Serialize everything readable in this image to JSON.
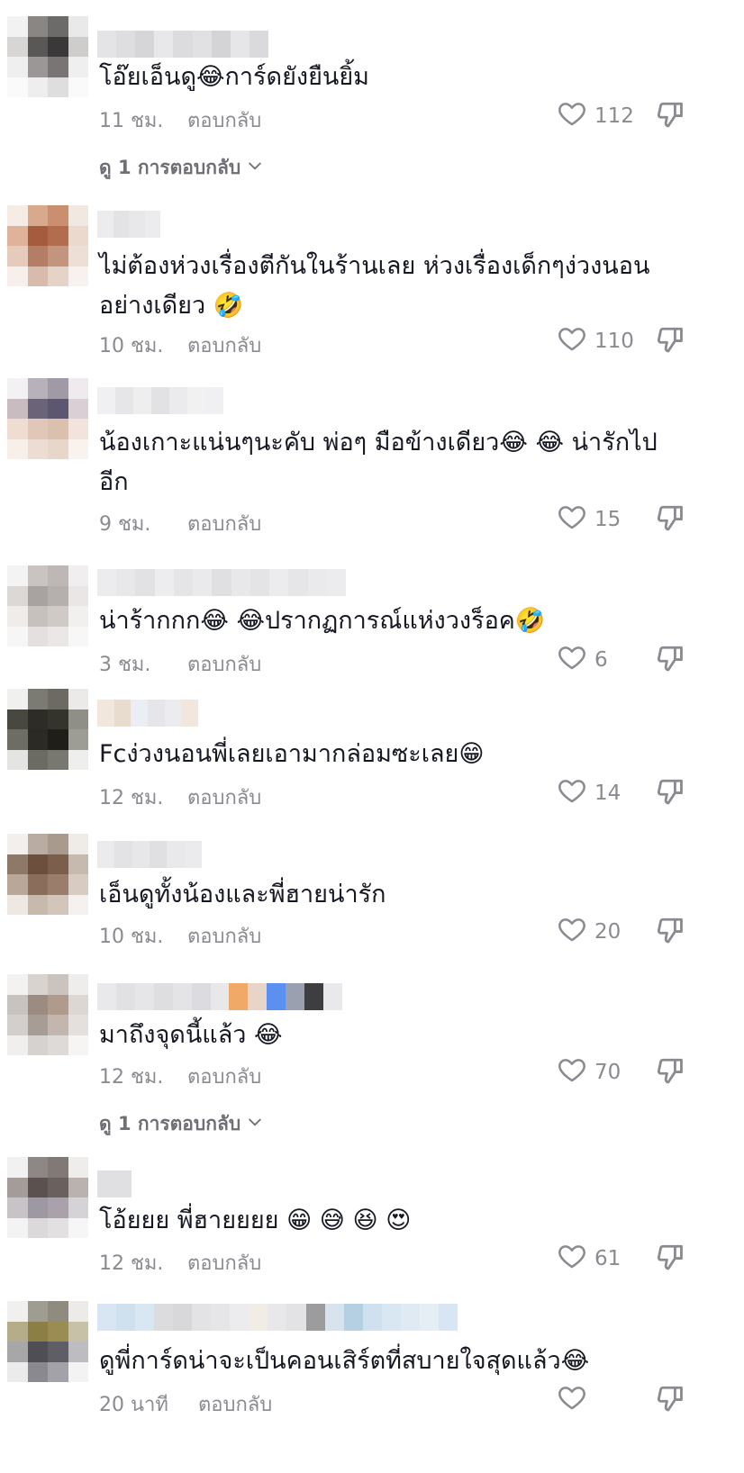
{
  "ui": {
    "reply_label": "ตอบกลับ",
    "text_color": "#161823",
    "meta_color": "#8a8b91",
    "icons": [
      "heart-outline-icon",
      "thumbs-down-icon",
      "chevron-down-icon"
    ]
  },
  "comments": [
    {
      "text": "โอ๊ยเอ็นดู😂การ์ดยังยืนยิ้ม",
      "time": "11 ชม.",
      "likes": "112",
      "view_replies": "ดู 1 การตอบกลับ"
    },
    {
      "text": "ไม่ต้องห่วงเรื่องตีกันในร้านเลย ห่วงเรื่องเด็กๆง่วงนอนอย่างเดียว 🤣",
      "time": "10 ชม.",
      "likes": "110"
    },
    {
      "text": "น้องเกาะแน่นๆนะคับ พ่อๆ มือข้างเดียว😂 😂 น่ารักไปอีก",
      "time": "9 ชม.",
      "likes": "15"
    },
    {
      "text": "น่าร้ากกก😂 😂ปรากฏการณ์แห่งวงร็อค🤣",
      "time": "3 ชม.",
      "likes": "6"
    },
    {
      "text": "Fcง่วงนอนพี่เลยเอามากล่อมซะเลย😁",
      "time": "12 ชม.",
      "likes": "14"
    },
    {
      "text": "เอ็นดูทั้งน้องและพี่ฮายน่ารัก",
      "time": "10 ชม.",
      "likes": "20"
    },
    {
      "text": "มาถึงจุดนี้แล้ว 😂",
      "time": "12 ชม.",
      "likes": "70",
      "view_replies": "ดู 1 การตอบกลับ"
    },
    {
      "text": "โอ้ยยย พี่ฮายยยย 😁 😅 😆 😍",
      "time": "12 ชม.",
      "likes": "61"
    },
    {
      "text": "ดูพี่การ์ดน่าจะเป็นคอนเสิร์ตที่สบายใจสุดแล้ว😂",
      "time": "20 นาที",
      "likes": ""
    }
  ]
}
